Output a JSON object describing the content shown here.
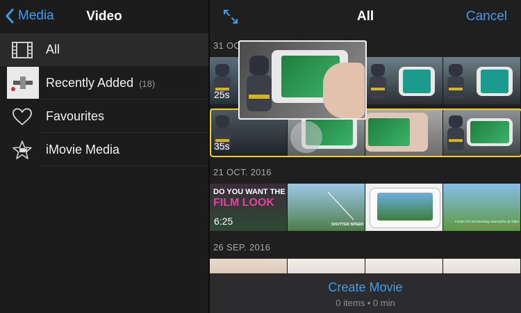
{
  "sidebar": {
    "back_label": "Media",
    "title": "Video",
    "items": [
      {
        "label": "All",
        "count": ""
      },
      {
        "label": "Recently Added",
        "count": "(18)"
      },
      {
        "label": "Favourites",
        "count": ""
      },
      {
        "label": "iMovie Media",
        "count": ""
      }
    ]
  },
  "main": {
    "title": "All",
    "cancel_label": "Cancel",
    "sections": [
      {
        "date": "31 OC",
        "clips": [
          {
            "duration": "25s"
          },
          {
            "duration": "35s"
          }
        ]
      },
      {
        "date": "21 OCT. 2016",
        "clips": [
          {
            "duration": "6:25",
            "overlay_line1": "DO YOU WANT THE",
            "overlay_line2": "FILM LOOK",
            "caption_shutter": "SHUTTER SPEED",
            "caption_filmic": "FILMIC Pro 4k Moondog Anamorphic @ 30fps",
            "caption_filmic2": "Shot without ND Filter - Shutter = 1/2000th"
          }
        ]
      },
      {
        "date": "26 SEP. 2016"
      }
    ]
  },
  "bottom": {
    "create_label": "Create Movie",
    "status": "0 items • 0 min"
  },
  "colors": {
    "accent": "#3d9df3",
    "highlight": "#f4cf2c",
    "background": "#1c1c1d"
  }
}
